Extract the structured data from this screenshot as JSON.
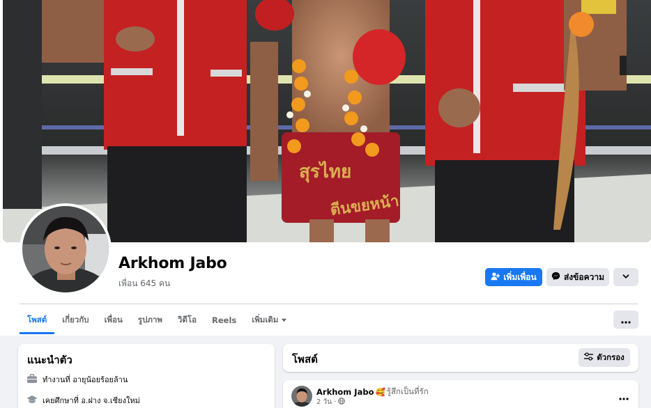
{
  "profile": {
    "name": "Arkhom Jabo",
    "friends_count": "เพื่อน 645 คน"
  },
  "actions": {
    "add_friend": "เพิ่มเพื่อน",
    "message": "ส่งข้อความ"
  },
  "tabs": [
    {
      "label": "โพสต์"
    },
    {
      "label": "เกี่ยวกับ"
    },
    {
      "label": "เพื่อน"
    },
    {
      "label": "รูปภาพ"
    },
    {
      "label": "วิดีโอ"
    },
    {
      "label": "Reels"
    },
    {
      "label": "เพิ่มเติม"
    }
  ],
  "intro": {
    "title": "แนะนำตัว",
    "items": [
      {
        "text": "ทำงานที่ อายุน้อยร้อยล้าน",
        "icon": "briefcase-icon"
      },
      {
        "text": "เคยศึกษาที่ อ.ฝาง จ.เชียงใหม่",
        "icon": "graduation-cap-icon"
      }
    ]
  },
  "posts_header": {
    "title": "โพสต์",
    "filter_label": "ตัวกรอง"
  },
  "post": {
    "author": "Arkhom Jabo",
    "feeling_emoji": "🥰",
    "feeling": "รู้สึกเป็นที่รัก",
    "time": "2 วัน ·"
  },
  "colors": {
    "primary": "#1877f2",
    "secondary_bg": "#e4e6eb",
    "page_bg": "#f0f2f5",
    "muted_text": "#65676b"
  }
}
